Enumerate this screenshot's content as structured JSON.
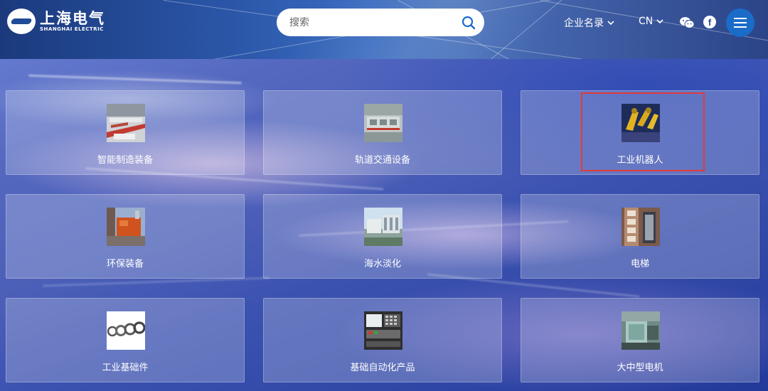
{
  "header": {
    "logo_cn": "上海电气",
    "logo_en": "SHANGHAI ELECTRIC",
    "search_placeholder": "搜索",
    "directory_label": "企业名录",
    "language_label": "CN"
  },
  "categories": [
    {
      "label": "智能制造装备"
    },
    {
      "label": "轨道交通设备"
    },
    {
      "label": "工业机器人"
    },
    {
      "label": "环保装备"
    },
    {
      "label": "海水淡化"
    },
    {
      "label": "电梯"
    },
    {
      "label": "工业基础件"
    },
    {
      "label": "基础自动化产品"
    },
    {
      "label": "大中型电机"
    }
  ],
  "colors": {
    "accent": "#1b6bc9",
    "highlight": "#e23a3a"
  }
}
